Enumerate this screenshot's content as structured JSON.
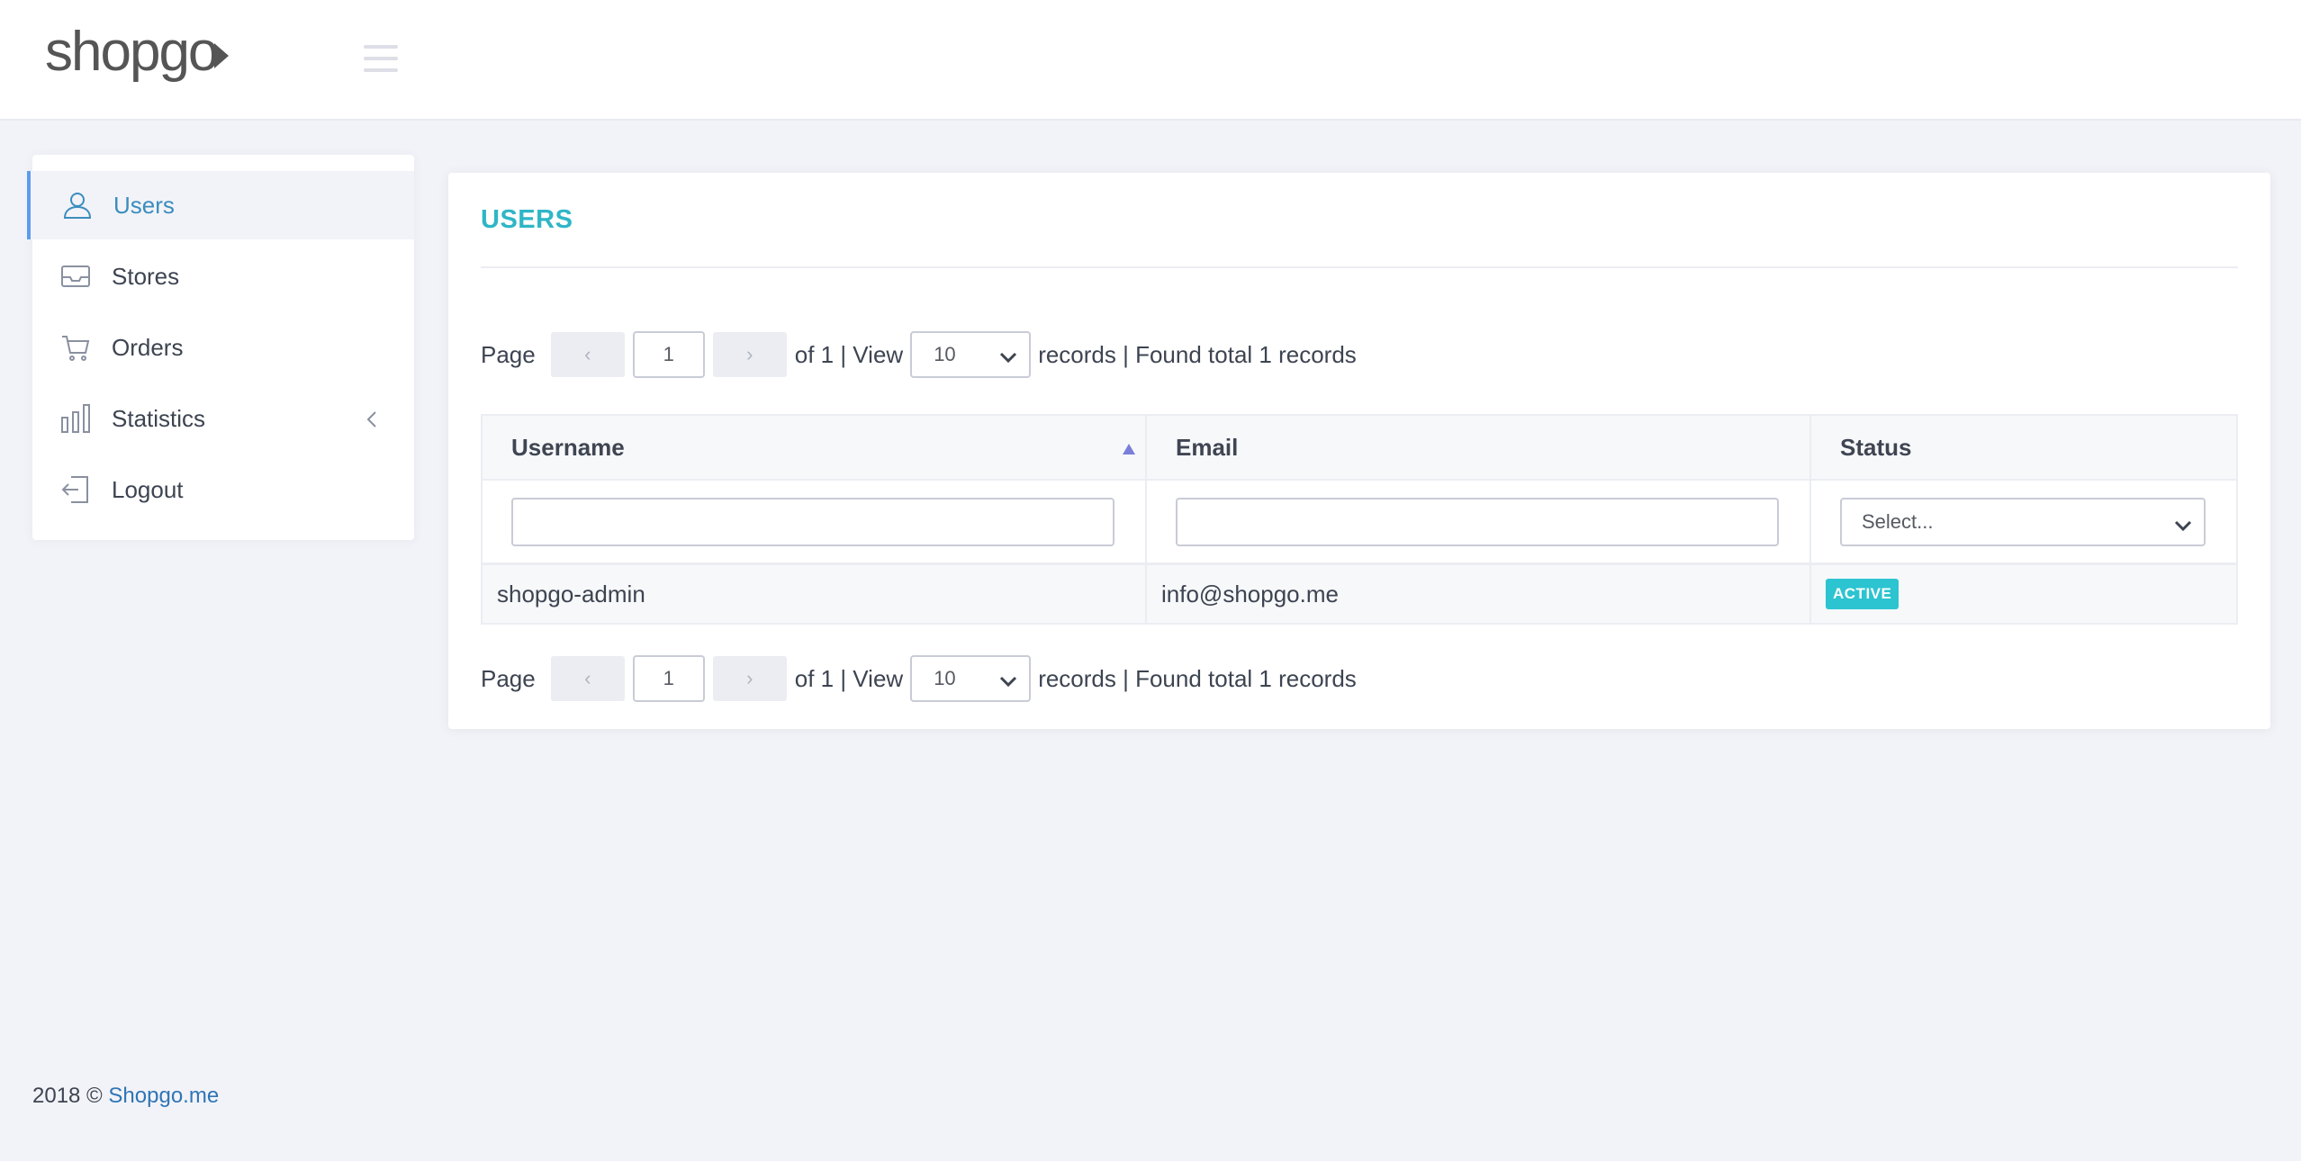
{
  "header": {
    "logo_text": "shopgo",
    "menu_icon": "hamburger-icon"
  },
  "sidebar": {
    "items": [
      {
        "label": "Users",
        "icon": "user-icon",
        "active": true
      },
      {
        "label": "Stores",
        "icon": "inbox-icon"
      },
      {
        "label": "Orders",
        "icon": "cart-icon"
      },
      {
        "label": "Statistics",
        "icon": "bar-chart-icon",
        "expand_icon": "chevron-left-icon"
      },
      {
        "label": "Logout",
        "icon": "logout-icon"
      }
    ]
  },
  "main": {
    "title": "USERS",
    "pager_top": {
      "page_label": "Page",
      "prev": "‹",
      "page_value": "1",
      "next": "›",
      "of_text": "of 1 | View",
      "view_value": "10",
      "records_text": "records | Found total 1 records"
    },
    "pager_bottom": {
      "page_label": "Page",
      "prev": "‹",
      "page_value": "1",
      "next": "›",
      "of_text": "of 1 | View",
      "view_value": "10",
      "records_text": "records | Found total 1 records"
    },
    "table": {
      "columns": [
        "Username",
        "Email",
        "Status"
      ],
      "filters": {
        "username": "",
        "email": "",
        "status_placeholder": "Select..."
      },
      "rows": [
        {
          "username": "shopgo-admin",
          "email": "info@shopgo.me",
          "status": "ACTIVE"
        }
      ]
    }
  },
  "footer": {
    "copyright": "2018 ©",
    "link": "Shopgo.me"
  },
  "colors": {
    "accent": "#2fb6c6",
    "active_nav": "#3b8dbd",
    "badge": "#2bc4d0",
    "link": "#2f75b5"
  }
}
